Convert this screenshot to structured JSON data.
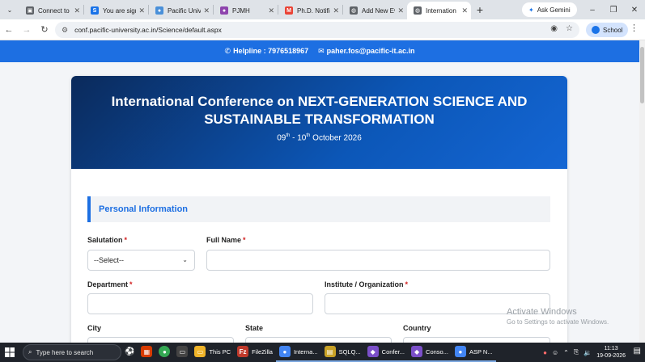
{
  "browser": {
    "tabs": [
      {
        "title": "Connect to netw",
        "fav_color": "#5f6368",
        "fav_glyph": "▣"
      },
      {
        "title": "You are signed",
        "fav_color": "#1a73e8",
        "fav_glyph": "S"
      },
      {
        "title": "Pacific Univers",
        "fav_color": "#4a90d9",
        "fav_glyph": "●"
      },
      {
        "title": "PJMH",
        "fav_color": "#8e44ad",
        "fav_glyph": "●"
      },
      {
        "title": "Ph.D. Notificat",
        "fav_color": "#ea4335",
        "fav_glyph": "M"
      },
      {
        "title": "Add New Ev",
        "fav_color": "#5f6368",
        "fav_glyph": "◍"
      },
      {
        "title": "Internation",
        "fav_color": "#5f6368",
        "fav_glyph": "◍",
        "active": true
      }
    ],
    "ask_gemini": "Ask Gemini",
    "url": "conf.pacific-university.ac.in/Science/default.aspx",
    "profile_label": "School"
  },
  "page": {
    "helpline": "Helpline : 7976518967",
    "email": "paher.fos@pacific-it.ac.in",
    "conference_title": "International Conference on NEXT-GENERATION SCIENCE AND SUSTAINABLE TRANSFORMATION",
    "dates": {
      "d1": "09",
      "s1": "th",
      "mid": " - 10",
      "s2": "th",
      "tail": " October 2026"
    },
    "section_title": "Personal Information",
    "labels": {
      "salutation": "Salutation",
      "full_name": "Full Name",
      "department": "Department",
      "institute": "Institute / Organization",
      "city": "City",
      "state": "State",
      "country": "Country"
    },
    "required_mark": "*",
    "salutation_value": "--Select--"
  },
  "watermark": {
    "line1": "Activate Windows",
    "line2": "Go to Settings to activate Windows."
  },
  "taskbar": {
    "search_placeholder": "Type here to search",
    "apps": [
      {
        "label": "This PC",
        "color": "#f0b429",
        "glyph": "▭"
      },
      {
        "label": "FileZilla",
        "color": "#c0392b",
        "glyph": "Fz"
      },
      {
        "label": "Interna...",
        "color": "#4285f4",
        "glyph": "●",
        "open": true
      },
      {
        "label": "SQLQ...",
        "color": "#c9a227",
        "glyph": "▤",
        "open": true
      },
      {
        "label": "Confer...",
        "color": "#7b4fc9",
        "glyph": "◆",
        "open": true
      },
      {
        "label": "Conso...",
        "color": "#7b4fc9",
        "glyph": "◆",
        "open": true
      },
      {
        "label": "ASP N...",
        "color": "#4285f4",
        "glyph": "●",
        "open": true
      }
    ],
    "time": "11:13",
    "date": "19-09-2026"
  }
}
